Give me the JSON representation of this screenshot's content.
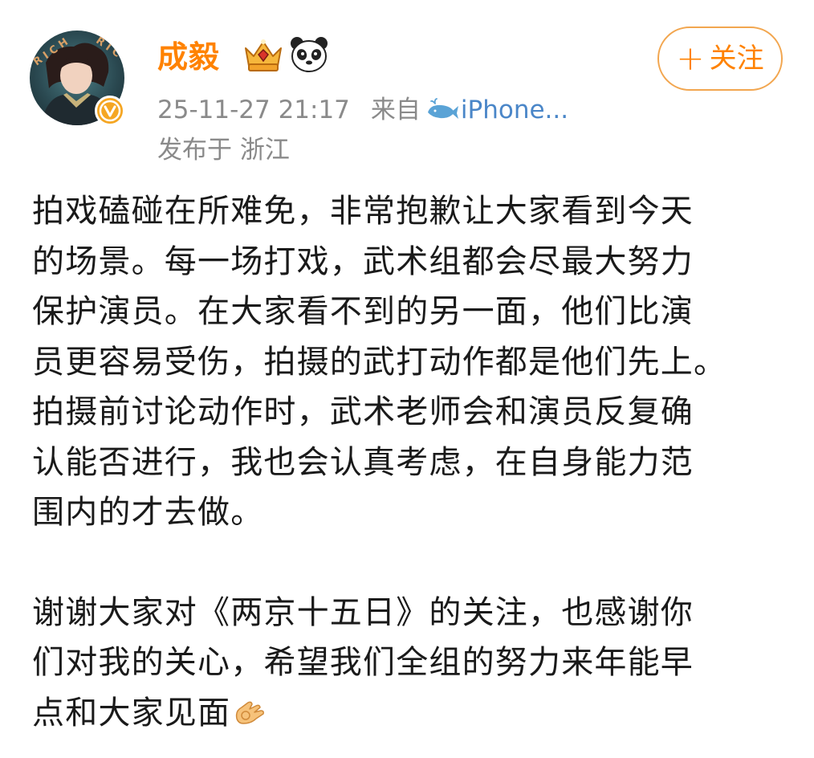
{
  "post": {
    "author": {
      "name": "成毅",
      "avatar_alt": "user-avatar",
      "badges": [
        "crown-icon",
        "panda-icon"
      ],
      "verified_icon": "verified-v-icon"
    },
    "follow_button": {
      "plus": "+",
      "label": "关注"
    },
    "meta": {
      "time": "25-11-27 21:17",
      "from_label": "来自",
      "source_icon": "whale-icon",
      "source": "iPhone...",
      "location": "发布于 浙江"
    },
    "body": {
      "paragraph_1_lines": [
        "拍戏磕碰在所难免，非常抱歉让大家看到今天",
        "的场景。每一场打戏，武术组都会尽最大努力",
        "保护演员。在大家看不到的另一面，他们比演",
        "员更容易受伤，拍摄的武打动作都是他们先上。",
        "拍摄前讨论动作时，武术老师会和演员反复确",
        "认能否进行，我也会认真考虑，在自身能力范",
        "围内的才去做。"
      ],
      "paragraph_2_lines": [
        "谢谢大家对《两京十五日》的关注，也感谢你",
        "们对我的关心，希望我们全组的努力来年能早",
        "点和大家见面"
      ],
      "trailing_emoji_icon": "ok-hand-icon"
    },
    "colors": {
      "accent": "#ff8200",
      "meta_gray": "#8a8a8a",
      "source_blue": "#4a86c8",
      "verified": "#f5a623"
    }
  }
}
